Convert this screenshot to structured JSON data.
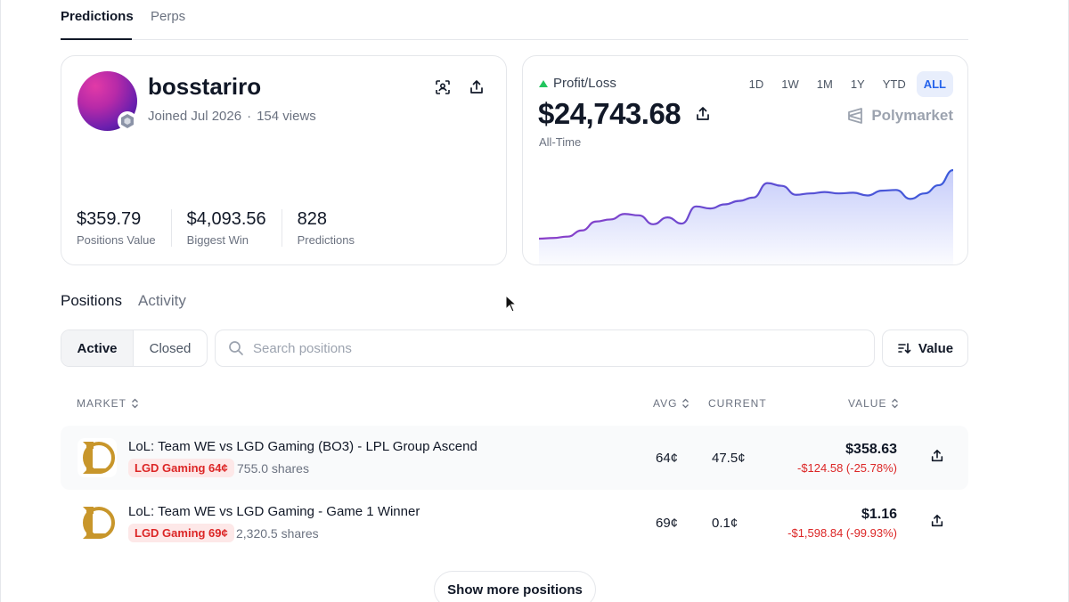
{
  "top_tabs": [
    {
      "label": "Predictions"
    },
    {
      "label": "Perps"
    }
  ],
  "profile": {
    "username": "bosstariro",
    "joined": "Joined Jul 2026",
    "views": "154 views",
    "stats": [
      {
        "value": "$359.79",
        "label": "Positions Value"
      },
      {
        "value": "$4,093.56",
        "label": "Biggest Win"
      },
      {
        "value": "828",
        "label": "Predictions"
      }
    ]
  },
  "pnl": {
    "label": "Profit/Loss",
    "value": "$24,743.68",
    "period": "All-Time",
    "brand": "Polymarket",
    "ranges": [
      "1D",
      "1W",
      "1M",
      "1Y",
      "YTD",
      "ALL"
    ],
    "active_range": "ALL",
    "trend_color": "#22c55e",
    "series": [
      0.0,
      0.01,
      0.03,
      0.12,
      0.25,
      0.28,
      0.36,
      0.34,
      0.21,
      0.31,
      0.22,
      0.47,
      0.44,
      0.5,
      0.55,
      0.6,
      0.81,
      0.77,
      0.64,
      0.66,
      0.68,
      0.66,
      0.67,
      0.63,
      0.7,
      0.71,
      0.58,
      0.66,
      0.78,
      1.0
    ]
  },
  "section_tabs": [
    {
      "label": "Positions"
    },
    {
      "label": "Activity"
    }
  ],
  "filters": {
    "active": "Active",
    "closed": "Closed"
  },
  "search": {
    "placeholder": "Search positions"
  },
  "sort": {
    "label": "Value"
  },
  "table": {
    "headers": {
      "market": "MARKET",
      "avg": "AVG",
      "current": "CURRENT",
      "value": "VALUE"
    },
    "rows": [
      {
        "title": "LoL: Team WE vs LGD Gaming (BO3) - LPL Group Ascend",
        "outcome": "LGD Gaming 64¢",
        "shares": "755.0 shares",
        "avg": "64¢",
        "current": "47.5¢",
        "value": "$358.63",
        "change": "-$124.58 (-25.78%)"
      },
      {
        "title": "LoL: Team WE vs LGD Gaming - Game 1 Winner",
        "outcome": "LGD Gaming 69¢",
        "shares": "2,320.5 shares",
        "avg": "69¢",
        "current": "0.1¢",
        "value": "$1.16",
        "change": "-$1,598.84 (-99.93%)"
      }
    ]
  },
  "show_more": "Show more positions",
  "colors": {
    "accent": "#2563eb",
    "loss": "#dc2626",
    "chart_line": "#5b3fd6"
  }
}
